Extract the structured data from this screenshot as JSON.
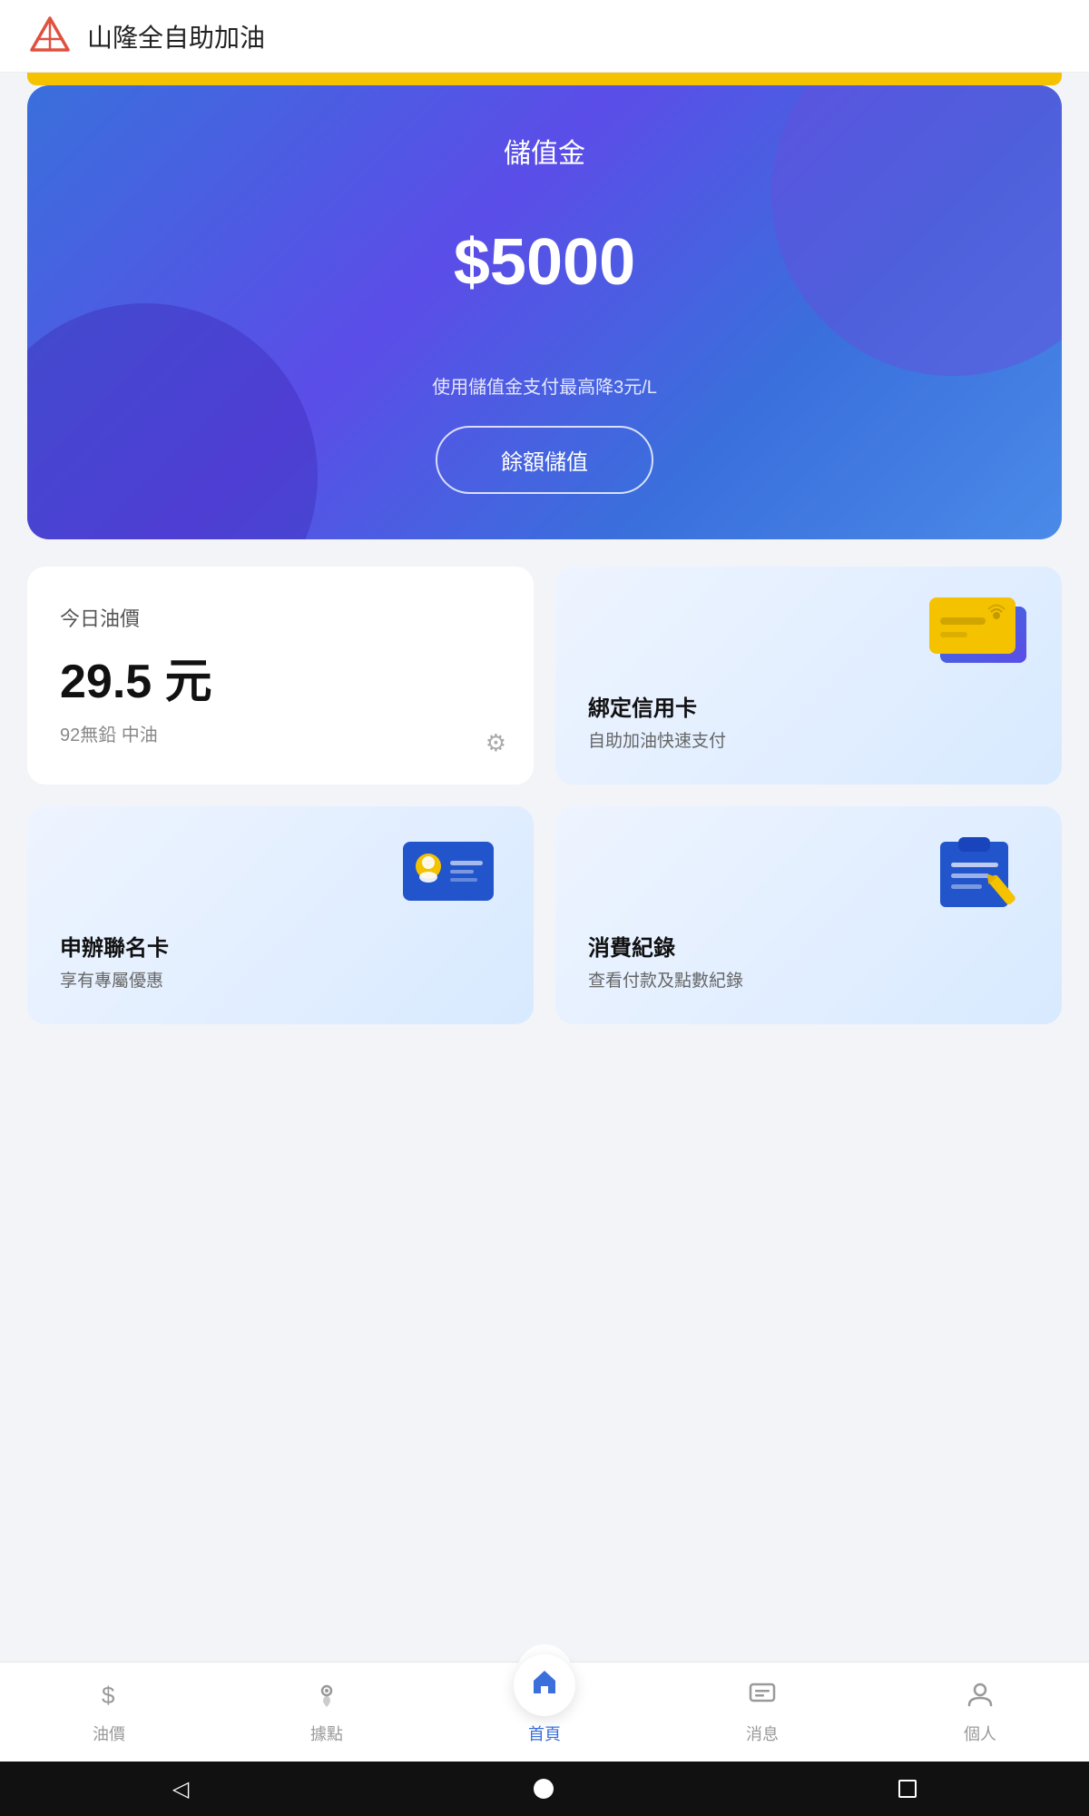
{
  "app": {
    "title": "山隆全自助加油"
  },
  "header": {
    "icon_alt": "mountain logo"
  },
  "yellow_bar": {},
  "blue_card": {
    "label": "儲值金",
    "amount": "$5000",
    "desc": "使用儲值金支付最高降3元/L",
    "btn_label": "餘額儲值"
  },
  "oil_price_card": {
    "header": "今日油價",
    "value": "29.5 元",
    "sub": "92無鉛 中油"
  },
  "credit_card": {
    "title": "綁定信用卡",
    "sub": "自助加油快速支付"
  },
  "member_card": {
    "title": "申辦聯名卡",
    "sub": "享有專屬優惠"
  },
  "receipt_card": {
    "title": "消費紀錄",
    "sub": "查看付款及點數紀錄"
  },
  "bottom_nav": {
    "items": [
      {
        "label": "油價",
        "icon": "dollar"
      },
      {
        "label": "據點",
        "icon": "location"
      },
      {
        "label": "首頁",
        "icon": "home",
        "active": true
      },
      {
        "label": "消息",
        "icon": "message"
      },
      {
        "label": "個人",
        "icon": "person"
      }
    ]
  }
}
